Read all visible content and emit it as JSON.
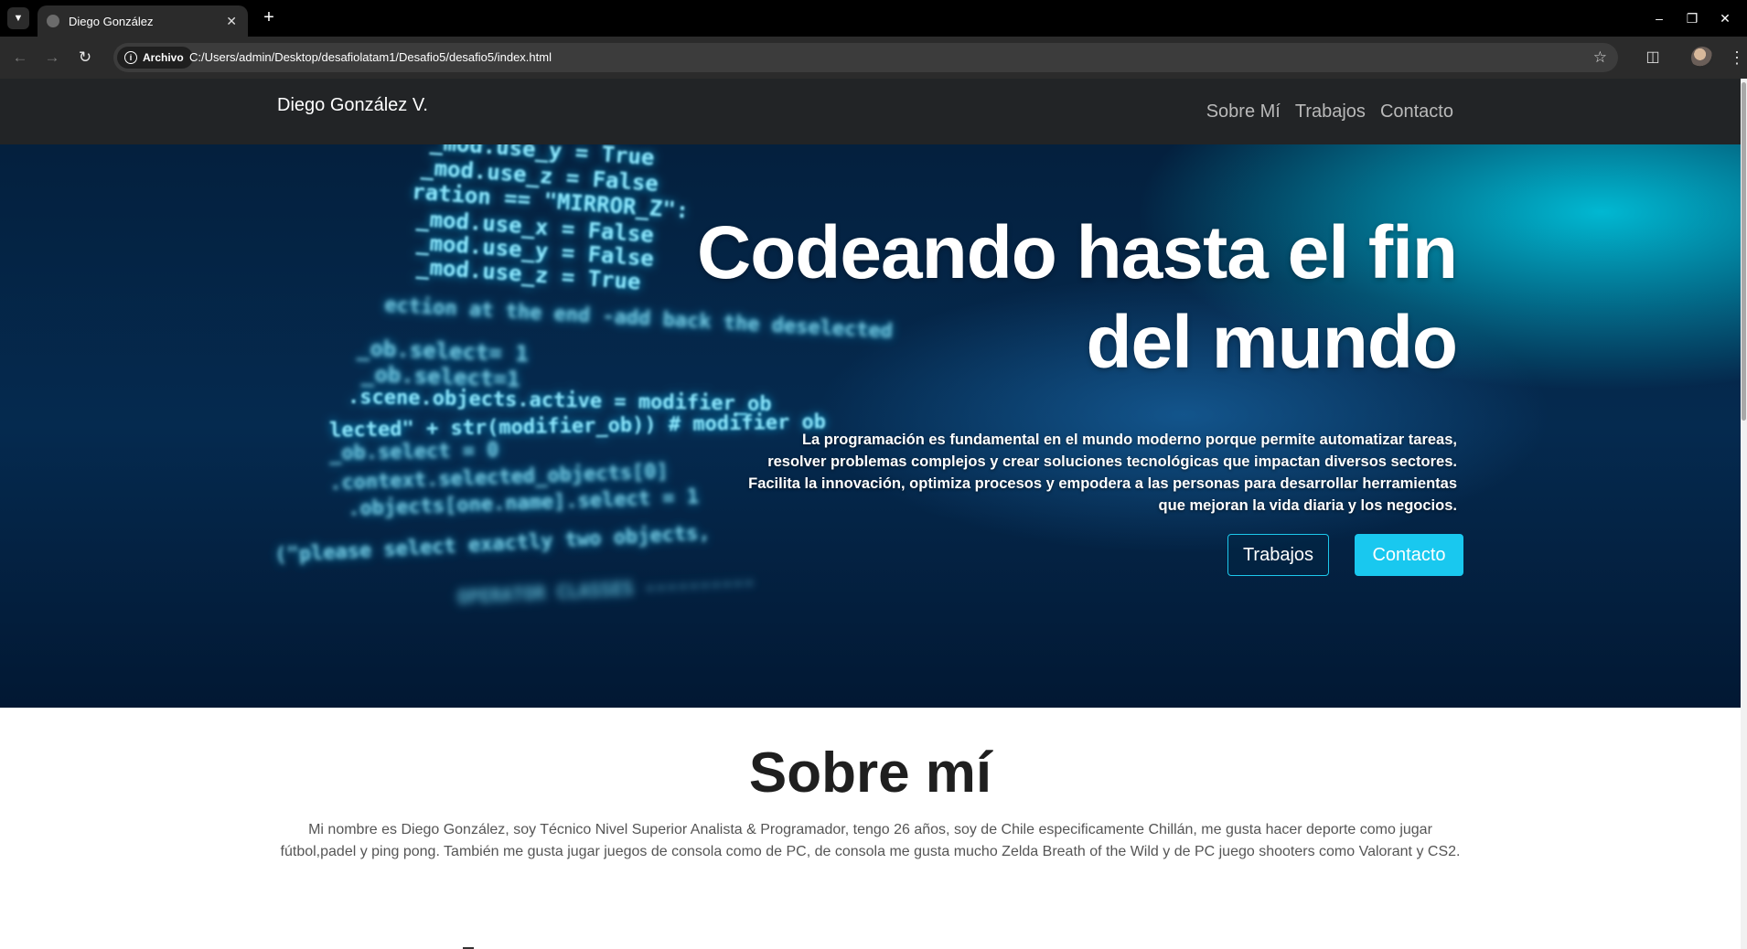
{
  "browser": {
    "tab_title": "Diego González",
    "new_tab_icon": "plus-icon",
    "omnibox_chip": "Archivo",
    "url": "C:/Users/admin/Desktop/desafiolatam1/Desafio5/desafio5/index.html"
  },
  "site": {
    "brand": "Diego González V.",
    "nav": [
      "Sobre Mí",
      "Trabajos",
      "Contacto"
    ]
  },
  "hero": {
    "title": "Codeando hasta el fin del mundo",
    "text": "La programación es fundamental en el mundo moderno porque permite automatizar tareas, resolver problemas complejos y crear soluciones tecnológicas que impactan diversos sectores. Facilita la innovación, optimiza procesos y empodera a las personas para desarrollar herramientas que mejoran la vida diaria y los negocios.",
    "buttons": [
      "Trabajos",
      "Contacto"
    ],
    "background_code": [
      "_mod.use_y = True",
      "_mod.use_z = False",
      "ration == \"MIRROR_Z\":",
      "_mod.use_x = False",
      "_mod.use_y = False",
      "_mod.use_z = True",
      "ection at the end -add back the deselected",
      "_ob.select= 1",
      "_ob.select=1",
      ".scene.objects.active = modifier_ob",
      "lected\" + str(modifier_ob)) # modifier ob",
      "_ob.select = 0",
      ".context.selected_objects[0]",
      ".objects[one.name].select = 1",
      "(\"please select exactly two objects,",
      "OPERATOR CLASSES ----------"
    ]
  },
  "about": {
    "title": "Sobre mí",
    "text": "Mi nombre es Diego González, soy Técnico Nivel Superior Analista & Programador, tengo 26 años, soy de Chile especificamente Chillán, me gusta hacer deporte como jugar fútbol,padel y ping pong. También me gusta jugar juegos de consola como de PC, de consola me gusta mucho Zelda Breath of the Wild y de PC juego shooters como Valorant y CS2."
  },
  "colors": {
    "navbar": "#222426",
    "accent": "#19c8ef",
    "chrome": "#2b2b2b"
  }
}
